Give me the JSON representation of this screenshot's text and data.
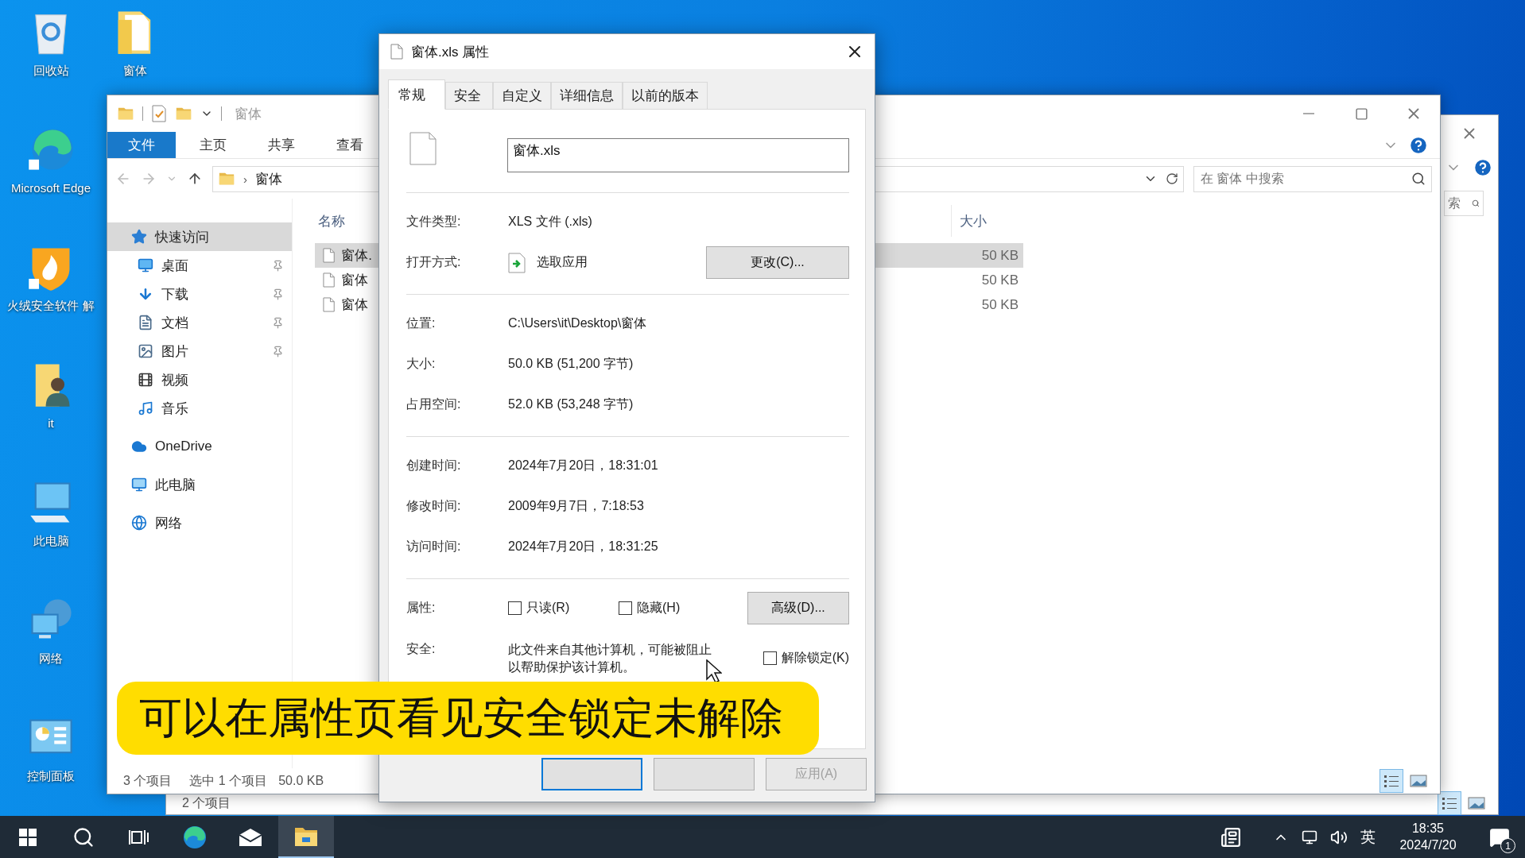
{
  "desktop": {
    "columns": [
      [
        {
          "label": "回收站",
          "kind": "recycle"
        },
        {
          "label": "Microsoft Edge",
          "kind": "edge"
        },
        {
          "label": "火绒安全软件 解",
          "kind": "shield"
        },
        {
          "label": "it",
          "kind": "user"
        },
        {
          "label": "此电脑",
          "kind": "pc"
        },
        {
          "label": "网络",
          "kind": "network"
        },
        {
          "label": "控制面板",
          "kind": "control"
        }
      ],
      [
        {
          "label": "窗体",
          "kind": "folder"
        }
      ]
    ]
  },
  "back_window": {
    "search_placeholder": "索",
    "status": "2 个项目"
  },
  "explorer": {
    "title": "窗体",
    "ribbon_tabs": [
      {
        "label": "文件",
        "selected": true
      },
      {
        "label": "主页",
        "selected": false
      },
      {
        "label": "共享",
        "selected": false
      },
      {
        "label": "查看",
        "selected": false
      }
    ],
    "address_separator": "›",
    "address": "窗体",
    "search_placeholder": "在 窗体 中搜索",
    "nav": [
      {
        "label": "快速访问",
        "kind": "star",
        "selected": true,
        "children": [
          {
            "label": "桌面",
            "kind": "desktop",
            "pinned": true,
            "selected": false
          },
          {
            "label": "下载",
            "kind": "download",
            "pinned": true,
            "selected": false
          },
          {
            "label": "文档",
            "kind": "docs",
            "pinned": true,
            "selected": false
          },
          {
            "label": "图片",
            "kind": "pictures",
            "pinned": true,
            "selected": false
          },
          {
            "label": "视频",
            "kind": "videos",
            "pinned": false,
            "selected": false
          },
          {
            "label": "音乐",
            "kind": "music",
            "pinned": false,
            "selected": false
          }
        ]
      },
      {
        "label": "OneDrive",
        "kind": "cloud",
        "selected": false
      },
      {
        "label": "此电脑",
        "kind": "pc",
        "selected": false
      },
      {
        "label": "网络",
        "kind": "network",
        "selected": false
      }
    ],
    "columns": [
      "名称",
      "大小"
    ],
    "files": [
      {
        "name": "窗体.",
        "size": "50 KB",
        "selected": true
      },
      {
        "name": "窗体",
        "size": "50 KB",
        "selected": false
      },
      {
        "name": "窗体",
        "size": "50 KB",
        "selected": false
      }
    ],
    "status": {
      "count": "3 个项目",
      "selection": "选中 1 个项目",
      "size": "50.0 KB"
    }
  },
  "dialog": {
    "title": "窗体.xls 属性",
    "tabs": [
      {
        "label": "常规",
        "selected": true
      },
      {
        "label": "安全",
        "selected": false
      },
      {
        "label": "自定义",
        "selected": false
      },
      {
        "label": "详细信息",
        "selected": false
      },
      {
        "label": "以前的版本",
        "selected": false
      }
    ],
    "file_name": "窗体.xls",
    "sections": [
      [
        {
          "label": "文件类型:",
          "value": "XLS 文件 (.xls)"
        },
        {
          "label": "打开方式:",
          "value": "选取应用",
          "kind": "app",
          "button": "更改(C)..."
        }
      ],
      [
        {
          "label": "位置:",
          "value": "C:\\Users\\it\\Desktop\\窗体"
        },
        {
          "label": "大小:",
          "value": "50.0 KB (51,200 字节)"
        },
        {
          "label": "占用空间:",
          "value": "52.0 KB (53,248 字节)"
        }
      ],
      [
        {
          "label": "创建时间:",
          "value": "2024年7月20日，18:31:01"
        },
        {
          "label": "修改时间:",
          "value": "2009年9月7日，7:18:53"
        },
        {
          "label": "访问时间:",
          "value": "2024年7月20日，18:31:25"
        }
      ]
    ],
    "attributes": {
      "label": "属性:",
      "checkboxes": [
        {
          "label": "只读(R)",
          "checked": false
        },
        {
          "label": "隐藏(H)",
          "checked": false
        }
      ],
      "button": "高级(D)..."
    },
    "security": {
      "label": "安全:",
      "text": "此文件来自其他计算机，可能被阻止以帮助保护该计算机。",
      "unblock": {
        "label": "解除锁定(K)",
        "checked": false
      }
    },
    "buttons": [
      {
        "kind": "default"
      },
      {
        "kind": "normal"
      },
      {
        "kind": "normal",
        "label": "应用(A)",
        "disabled": true
      }
    ]
  },
  "caption": "可以在属性页看见安全锁定未解除",
  "taskbar": {
    "apps": [
      {
        "kind": "start",
        "selected": false
      },
      {
        "kind": "search",
        "selected": false
      },
      {
        "kind": "taskview",
        "selected": false
      },
      {
        "kind": "edge",
        "selected": false
      },
      {
        "kind": "mail",
        "selected": false
      },
      {
        "kind": "explorer",
        "selected": true
      }
    ],
    "ime": "英",
    "time": "18:35",
    "date": "2024/7/20",
    "notifications": "1"
  }
}
